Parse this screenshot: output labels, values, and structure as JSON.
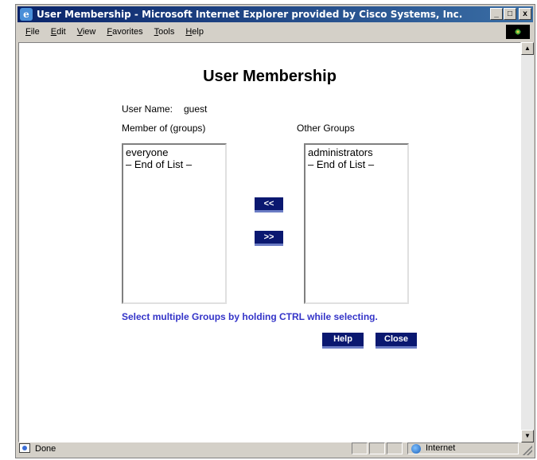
{
  "window": {
    "title": "User Membership - Microsoft Internet Explorer provided by Cisco Systems, Inc.",
    "minimize": "_",
    "maximize": "□",
    "close": "x"
  },
  "menu": [
    "File",
    "Edit",
    "View",
    "Favorites",
    "Tools",
    "Help"
  ],
  "page": {
    "title": "User Membership",
    "user_name_label": "User Name:",
    "user_name_value": "guest",
    "member_of_label": "Member of (groups)",
    "other_groups_label": "Other Groups",
    "member_of_items": [
      "everyone",
      "– End of List –"
    ],
    "other_groups_items": [
      "administrators",
      "– End of List –"
    ],
    "move_left_label": "<<",
    "move_right_label": ">>",
    "hint": "Select multiple Groups by holding CTRL while selecting.",
    "help_label": "Help",
    "close_label": "Close"
  },
  "status": {
    "text": "Done",
    "zone": "Internet"
  },
  "colors": {
    "button_bg": "#0a1870",
    "hint_text": "#3434c8",
    "titlebar": "#0a246a"
  }
}
